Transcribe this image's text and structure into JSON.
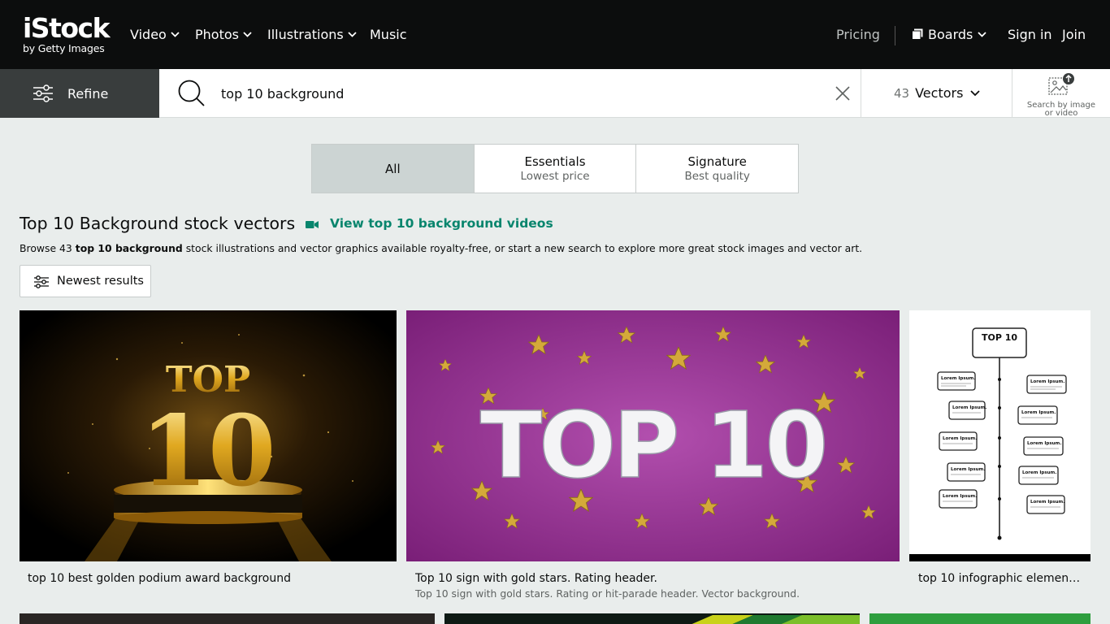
{
  "brand": {
    "logo_main": "iStock",
    "logo_sub": "by Getty Images"
  },
  "nav": {
    "items": [
      {
        "label": "Video"
      },
      {
        "label": "Photos"
      },
      {
        "label": "Illustrations"
      },
      {
        "label": "Music"
      }
    ],
    "pricing": "Pricing",
    "boards": "Boards",
    "sign_in": "Sign in",
    "join": "Join"
  },
  "search": {
    "refine_label": "Refine",
    "query": "top 10 background",
    "asset_count": "43",
    "asset_type": "Vectors",
    "image_search_caption": "Search by image or video"
  },
  "tabs": [
    {
      "title": "All",
      "subtitle": ""
    },
    {
      "title": "Essentials",
      "subtitle": "Lowest price"
    },
    {
      "title": "Signature",
      "subtitle": "Best quality"
    }
  ],
  "page": {
    "title": "Top 10 Background stock vectors",
    "video_link": "View top 10 background videos",
    "browse_prefix": "Browse 43 ",
    "browse_bold": "top 10 background",
    "browse_suffix": " stock illustrations and vector graphics available royalty-free, or start a new search to explore more great stock images and vector art.",
    "sort_label": "Newest results"
  },
  "results": [
    {
      "caption": "top 10 best golden podium award background",
      "description": "",
      "art_title": "TOP",
      "art_number": "10"
    },
    {
      "caption": "Top 10 sign with gold stars. Rating header.",
      "description": "Top 10 sign with gold stars. Rating or hit-parade header. Vector background.",
      "art_title": "TOP 10"
    },
    {
      "caption": "top 10 infographic elements ...",
      "description": "",
      "art_title": "TOP 10",
      "art_item": "Lorem Ipsum."
    }
  ],
  "colors": {
    "accent_green": "#08856d",
    "nav_bg": "#0c0d0d",
    "page_bg": "#e9edec"
  }
}
